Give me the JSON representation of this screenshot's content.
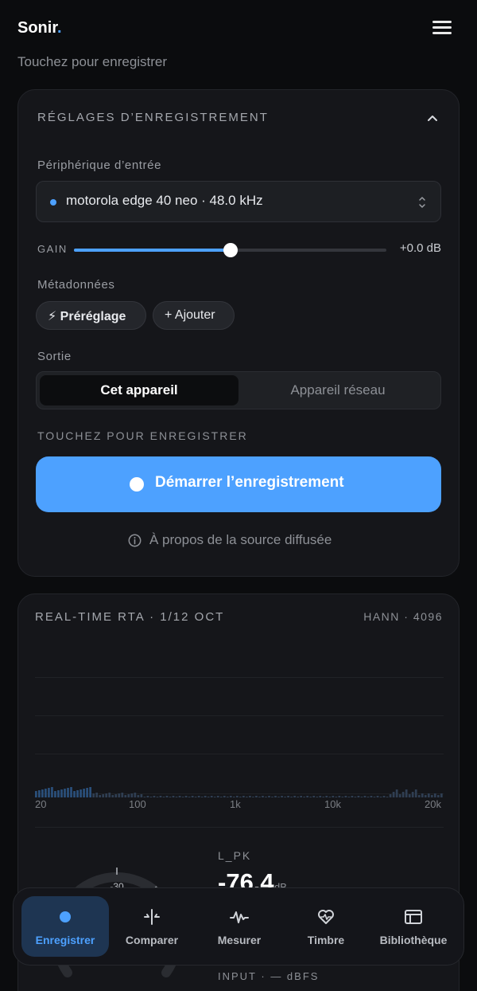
{
  "app": {
    "name": "Sonir",
    "name_dot": ".",
    "subtitle": "Touchez pour enregistrer"
  },
  "settings": {
    "title": "RÉGLAGES D’ENREGISTREMENT",
    "device_label": "Périphérique d’entrée",
    "device_value": "motorola edge 40 neo · 48.0 kHz",
    "gain_label": "GAIN",
    "gain_value": "+0.0 dB",
    "gain_level": 0.5,
    "metadata_label": "Métadonnées",
    "preset_chip": "⚡ Préréglage",
    "add_chip": "+ Ajouter",
    "output_label": "Sortie",
    "output_options": [
      "Cet appareil",
      "Appareil réseau"
    ],
    "output_selected": "Cet appareil",
    "tap_label": "TOUCHEZ POUR ENREGISTRER",
    "record_button": "Démarrer l’enregistrement",
    "about_link": "À propos de la source diffusée"
  },
  "rta": {
    "title": "REAL-TIME RTA · 1/12 OCT",
    "meta": "HANN · 4096",
    "x_ticks": [
      "20",
      "100",
      "1k",
      "10k",
      "20k"
    ],
    "pk_label": "L_PK",
    "pk_value": "-76.4",
    "pk_unit": "dB",
    "input_label": "INPUT · — dBFS",
    "gauge_tick": "-30"
  },
  "nav": {
    "items": [
      {
        "label": "Enregistrer",
        "icon": "record-dot-icon"
      },
      {
        "label": "Comparer",
        "icon": "compare-icon"
      },
      {
        "label": "Mesurer",
        "icon": "waveform-icon"
      },
      {
        "label": "Timbre",
        "icon": "heart-pulse-icon"
      },
      {
        "label": "Bibliothèque",
        "icon": "library-icon"
      }
    ],
    "active": "Enregistrer"
  },
  "colors": {
    "accent": "#4da1ff",
    "background": "#0b0c0e",
    "card": "#15161a"
  }
}
